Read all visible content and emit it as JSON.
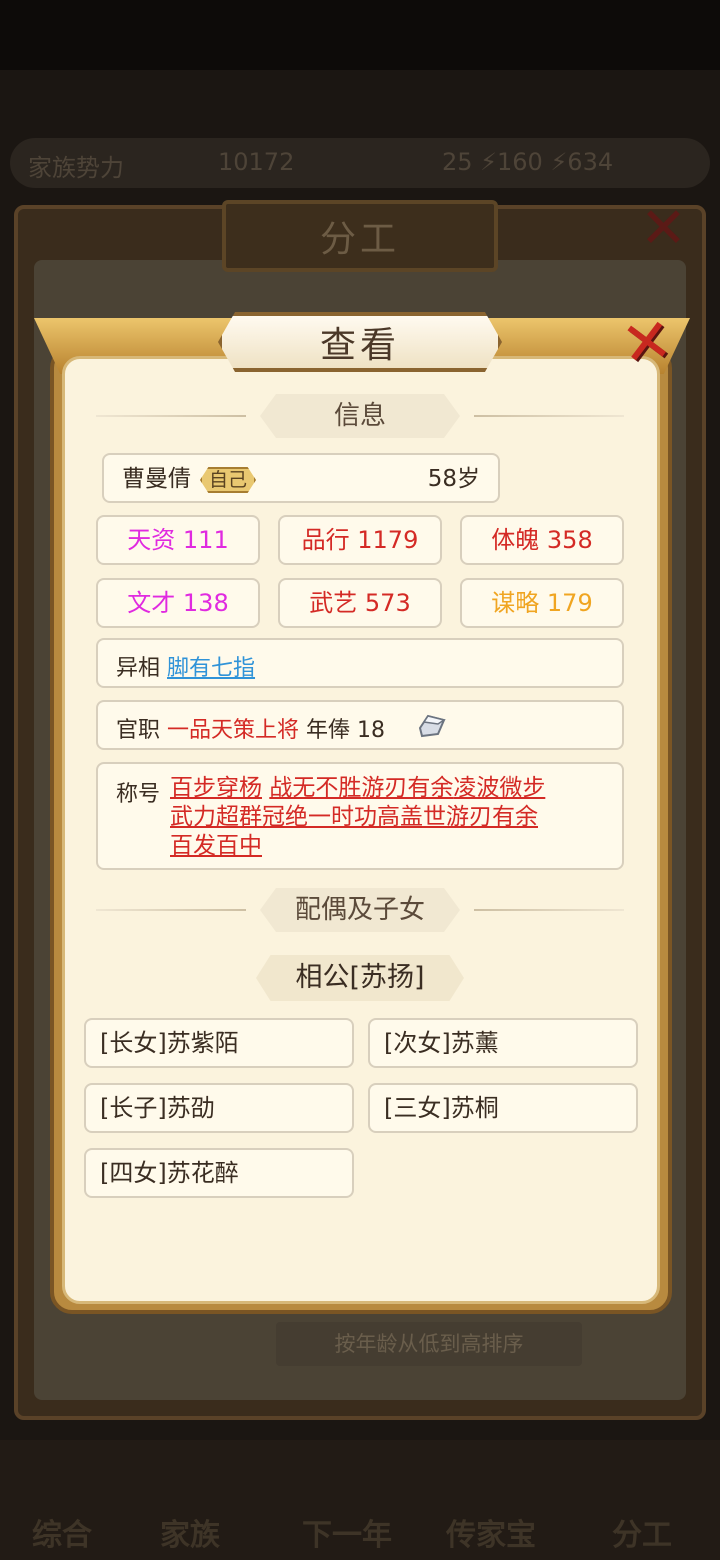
{
  "background": {
    "header_label": "家族势力",
    "header_value": "10172",
    "header_stats": "25 ⚡160 ⚡634",
    "panel_title": "分工",
    "sort_label": "按年龄从低到高排序",
    "nav": [
      "综合",
      "家族",
      "下一年",
      "传家宝",
      "分工"
    ]
  },
  "modal": {
    "title": "查看",
    "section_info": "信息",
    "person": {
      "name": "曹曼倩",
      "self_tag": "自己",
      "age": "58岁"
    },
    "stats": [
      {
        "label": "天资 111",
        "color": "#e02ae0"
      },
      {
        "label": "品行 1179",
        "color": "#d42a25"
      },
      {
        "label": "体魄 358",
        "color": "#d42a25"
      },
      {
        "label": "文才 138",
        "color": "#e02ae0"
      },
      {
        "label": "武艺 573",
        "color": "#d42a25"
      },
      {
        "label": "谋略 179",
        "color": "#f0a521"
      }
    ],
    "trait": {
      "label": "异相",
      "value": "脚有七指"
    },
    "office": {
      "label": "官职",
      "position": "一品天策上将",
      "salary_label": "年俸",
      "salary_value": "18",
      "salary_icon": "silver-ingot-icon"
    },
    "titles": {
      "label": "称号",
      "items": [
        "百步穿杨",
        "战无不胜",
        "游刃有余",
        "凌波微步",
        "武力超群",
        "冠绝一时",
        "功高盖世",
        "游刃有余",
        "百发百中"
      ]
    },
    "section_family": "配偶及子女",
    "spouse": "相公[苏扬]",
    "children": [
      "[长女]苏紫陌",
      "[次女]苏薰",
      "[长子]苏劭",
      "[三女]苏桐",
      "[四女]苏花醉"
    ]
  }
}
